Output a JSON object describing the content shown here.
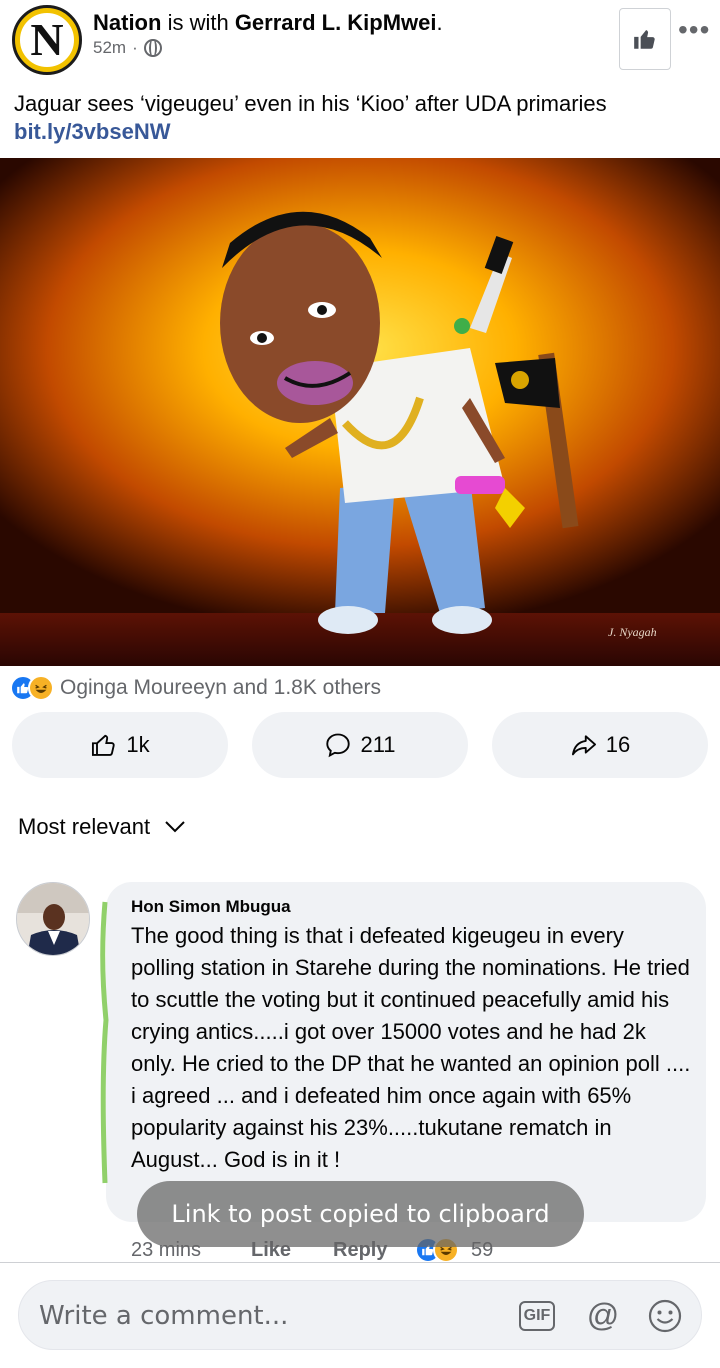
{
  "post": {
    "page_logo_letter": "N",
    "title_page": "Nation",
    "title_connector": " is with ",
    "title_person": "Gerrard L. KipMwei",
    "title_end": ".",
    "time": "52m",
    "caption": "Jaguar sees ‘vigeugeu’ even in his ‘Kioo’ after UDA primaries ",
    "caption_link": "bit.ly/3vbseNW",
    "more_label": "•••"
  },
  "image": {
    "signature": "J. Nyagah"
  },
  "reactions": {
    "summary": "Oginga Moureeyn and 1.8K others"
  },
  "actions": {
    "like_count": "1k",
    "comment_count": "211",
    "share_count": "16"
  },
  "comments": {
    "sort_label": "Most relevant",
    "items": [
      {
        "author": "Hon Simon Mbugua",
        "text": "The good thing is that i defeated kigeugeu in every polling station in Starehe during  the nominations. He tried to scuttle the voting but it continued peacefully amid his crying antics.....i got over 15000 votes and he had 2k only.  He cried  to the DP that he wanted an opinion poll .... i agreed ... and i defeated him once again  with 65% popularity against his 23%.....tukutane rematch in August... God is in it  !",
        "time": "23 mins",
        "like_label": "Like",
        "reply_label": "Reply",
        "reaction_count": "59"
      }
    ]
  },
  "toast": {
    "message": "Link to post copied to clipboard"
  },
  "composer": {
    "placeholder": "Write a comment...",
    "gif_label": "GIF",
    "at_label": "@"
  },
  "colors": {
    "link": "#385898",
    "like_blue": "#1877f2",
    "haha_yellow": "#f7b125",
    "pill_bg": "#f0f2f5",
    "secondary_text": "#65676b"
  }
}
